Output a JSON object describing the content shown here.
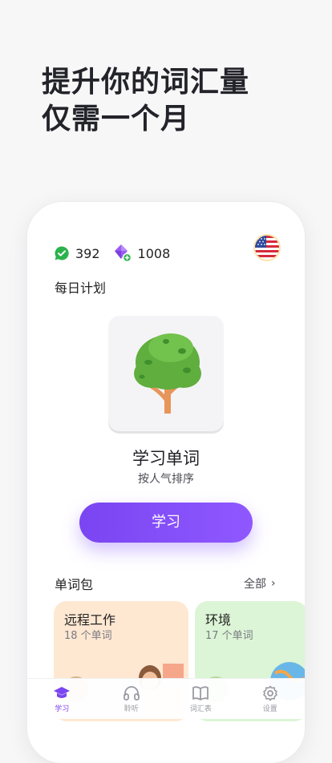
{
  "headline": {
    "line1": "提升你的词汇量",
    "line2": "仅需一个月"
  },
  "stats": {
    "streak": "392",
    "gems": "1008"
  },
  "daily_plan": {
    "section_title": "每日计划",
    "title": "学习单词",
    "subtitle": "按人气排序",
    "button_label": "学习"
  },
  "packs": {
    "section_title": "单词包",
    "all_label": "全部",
    "items": [
      {
        "name": "远程工作",
        "count": "18 个单词"
      },
      {
        "name": "环境",
        "count": "17 个单词"
      }
    ]
  },
  "tabbar": {
    "items": [
      {
        "label": "学习",
        "icon": "graduation-cap-icon",
        "active": true
      },
      {
        "label": "聆听",
        "icon": "headphones-icon",
        "active": false
      },
      {
        "label": "词汇表",
        "icon": "book-icon",
        "active": false
      },
      {
        "label": "设置",
        "icon": "gear-icon",
        "active": false
      }
    ]
  },
  "colors": {
    "accent": "#7a45f2",
    "streak_green": "#2bb24c",
    "pack1_bg": "#ffe8d2",
    "pack2_bg": "#dcf5d6"
  }
}
